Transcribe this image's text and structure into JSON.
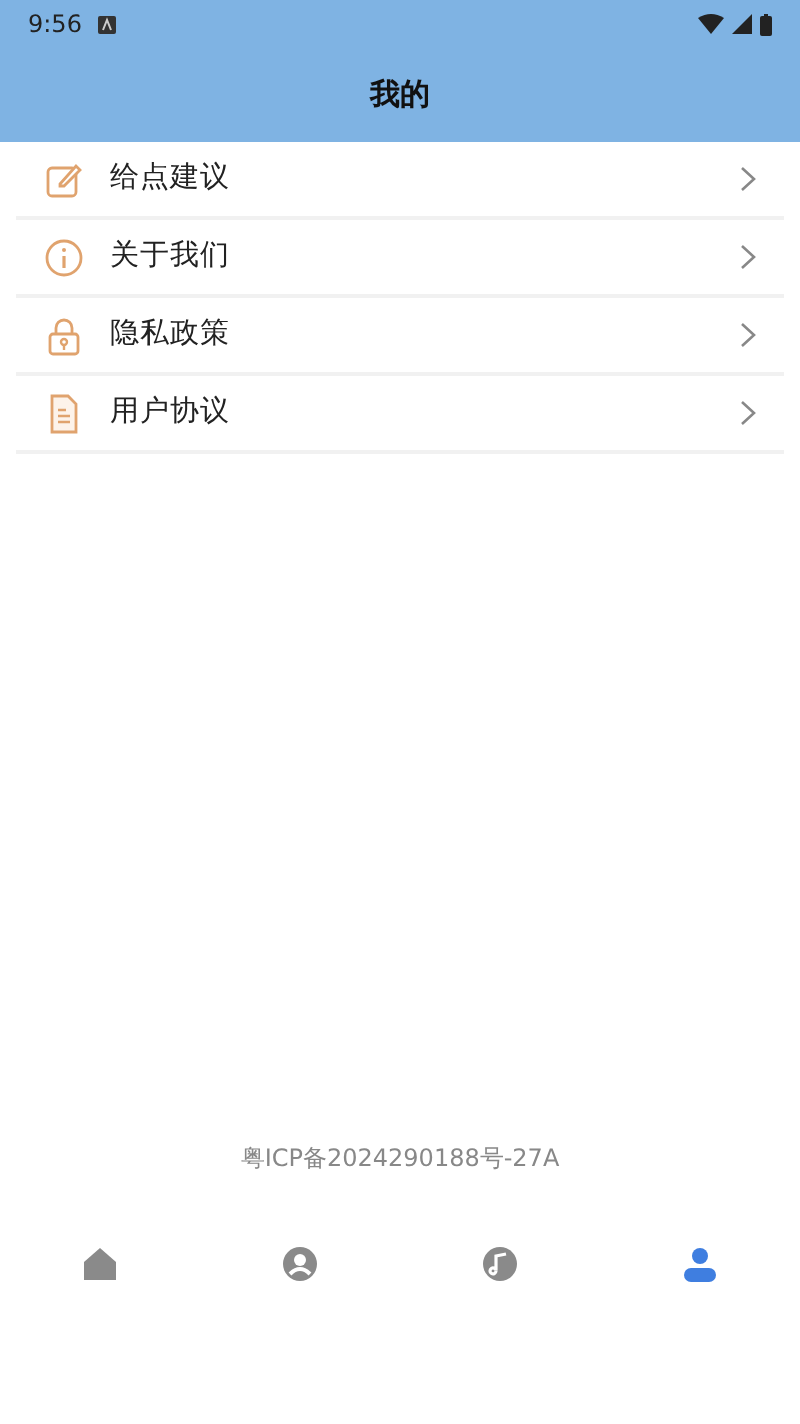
{
  "status_bar": {
    "time": "9:56"
  },
  "header": {
    "title": "我的"
  },
  "menu": [
    {
      "kind": "edit",
      "label": "给点建议"
    },
    {
      "kind": "info",
      "label": "关于我们"
    },
    {
      "kind": "lock",
      "label": "隐私政策"
    },
    {
      "kind": "document",
      "label": "用户协议"
    }
  ],
  "footer": {
    "icp": "粤ICP备2024290188号-27A"
  },
  "bottom_nav": [
    {
      "kind": "home",
      "selected": false
    },
    {
      "kind": "profile",
      "selected": false
    },
    {
      "kind": "music",
      "selected": false
    },
    {
      "kind": "user",
      "selected": true
    }
  ]
}
